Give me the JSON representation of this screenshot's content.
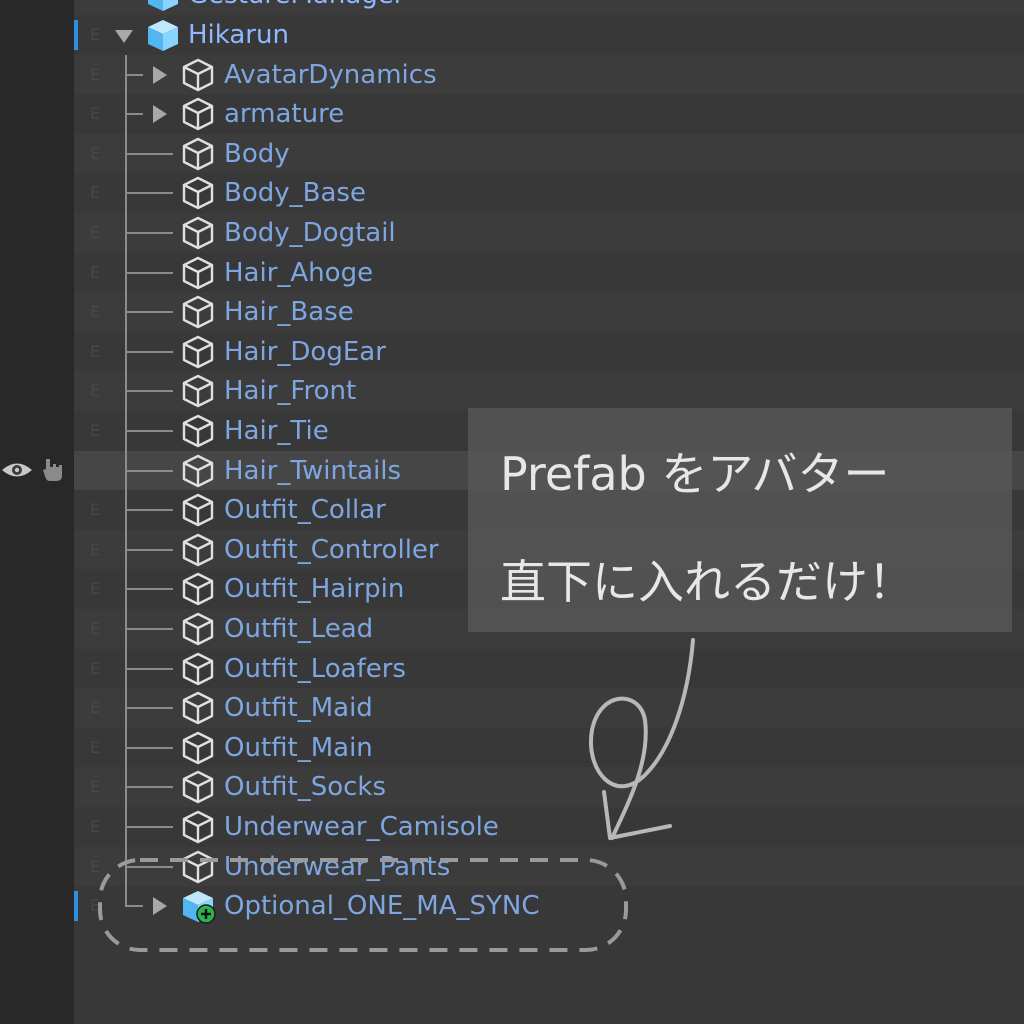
{
  "hierarchy": {
    "top_partial_label": "GestureManager",
    "root": {
      "label": "Hikarun",
      "expanded": true,
      "icon": "prefab-cube-icon"
    },
    "visibility_toggle_letter": "E",
    "children": [
      {
        "label": "AvatarDynamics",
        "expandable": true
      },
      {
        "label": "armature",
        "expandable": true
      },
      {
        "label": "Body",
        "expandable": false
      },
      {
        "label": "Body_Base",
        "expandable": false
      },
      {
        "label": "Body_Dogtail",
        "expandable": false
      },
      {
        "label": "Hair_Ahoge",
        "expandable": false
      },
      {
        "label": "Hair_Base",
        "expandable": false
      },
      {
        "label": "Hair_DogEar",
        "expandable": false
      },
      {
        "label": "Hair_Front",
        "expandable": false
      },
      {
        "label": "Hair_Tie",
        "expandable": false
      },
      {
        "label": "Hair_Twintails",
        "expandable": false
      },
      {
        "label": "Outfit_Collar",
        "expandable": false
      },
      {
        "label": "Outfit_Controller",
        "expandable": false
      },
      {
        "label": "Outfit_Hairpin",
        "expandable": false
      },
      {
        "label": "Outfit_Lead",
        "expandable": false
      },
      {
        "label": "Outfit_Loafers",
        "expandable": false
      },
      {
        "label": "Outfit_Maid",
        "expandable": false
      },
      {
        "label": "Outfit_Main",
        "expandable": false
      },
      {
        "label": "Outfit_Socks",
        "expandable": false
      },
      {
        "label": "Underwear_Camisole",
        "expandable": false
      },
      {
        "label": "Underwear_Pants",
        "expandable": false
      },
      {
        "label": "Optional_ONE_MA_SYNC",
        "expandable": true,
        "added_prefab": true
      }
    ]
  },
  "callout": {
    "line1": "Prefab をアバター",
    "line2": "直下に入れるだけ！"
  },
  "colors": {
    "label": "#7ea6e0",
    "root_label": "#8fb8ff",
    "selection_marker": "#2f8fe0",
    "added_badge": "#2bb24c"
  }
}
